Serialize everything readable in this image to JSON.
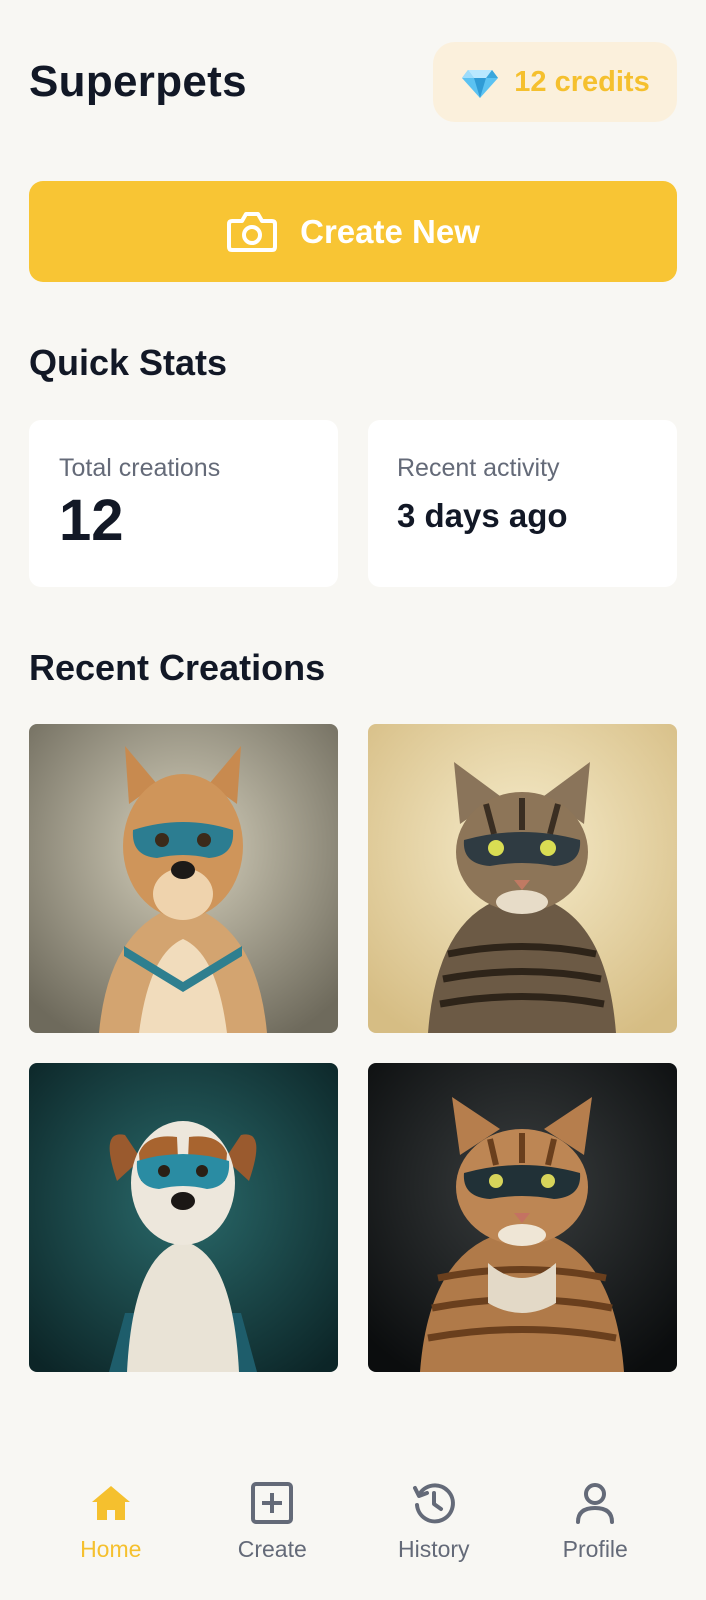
{
  "app": {
    "title": "Superpets"
  },
  "credits": {
    "label": "12 credits",
    "icon": "diamond-icon"
  },
  "create_button": {
    "label": "Create New",
    "icon": "camera-icon"
  },
  "quick_stats": {
    "title": "Quick Stats",
    "total": {
      "label": "Total creations",
      "value": "12"
    },
    "recent": {
      "label": "Recent activity",
      "value": "3 days ago"
    }
  },
  "recent_creations": {
    "title": "Recent Creations",
    "items": [
      {
        "subject": "dog",
        "mask": "teal"
      },
      {
        "subject": "cat",
        "mask": "dark"
      },
      {
        "subject": "dog",
        "mask": "teal"
      },
      {
        "subject": "cat",
        "mask": "dark"
      }
    ]
  },
  "nav": {
    "items": [
      {
        "label": "Home",
        "icon": "home-icon",
        "active": true
      },
      {
        "label": "Create",
        "icon": "plus-square-icon",
        "active": false
      },
      {
        "label": "History",
        "icon": "history-icon",
        "active": false
      },
      {
        "label": "Profile",
        "icon": "user-icon",
        "active": false
      }
    ]
  },
  "colors": {
    "accent": "#f8c534",
    "credit_text": "#f5c02e",
    "background": "#f8f7f3",
    "muted": "#646a78"
  }
}
